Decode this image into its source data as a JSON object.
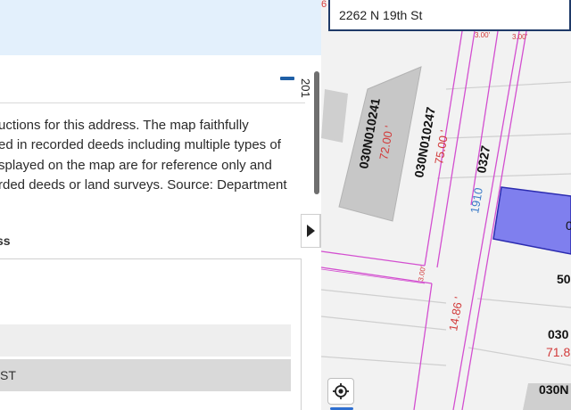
{
  "left_panel": {
    "description_lines": [
      "uctions for this address. The map faithfully",
      "ed in recorded deeds including multiple types of",
      "splayed on the map are for reference only and",
      "rded deeds or land surveys. Source: Department"
    ],
    "section_label": "ss",
    "selected_row": "ST",
    "scroll_label": "201"
  },
  "search": {
    "value": "2262 N 19th St"
  },
  "map": {
    "corner_label": "6",
    "parcels": [
      {
        "id": "030N010241",
        "dim": "72.00 '"
      },
      {
        "id": "030N010247",
        "dim": "75.00 '"
      },
      {
        "id": "0327"
      },
      {
        "id": "1910"
      }
    ],
    "street_dim": "14.86 '",
    "small_dims": [
      "3.00'",
      "3.00'",
      "3.00'"
    ],
    "right_labels": [
      "0",
      "50",
      "030",
      "71.8",
      "030N"
    ]
  },
  "colors": {
    "accent": "#1f5fa6",
    "parcel_line": "#d34fd0",
    "dimension_text": "#d23b3b",
    "highlight_fill": "#7f7fee"
  },
  "icons": {
    "collapse": "minus-icon",
    "toggle_left_panel": "caret-right-icon",
    "toggle_map": "caret-left-icon",
    "locate": "crosshair-icon"
  }
}
